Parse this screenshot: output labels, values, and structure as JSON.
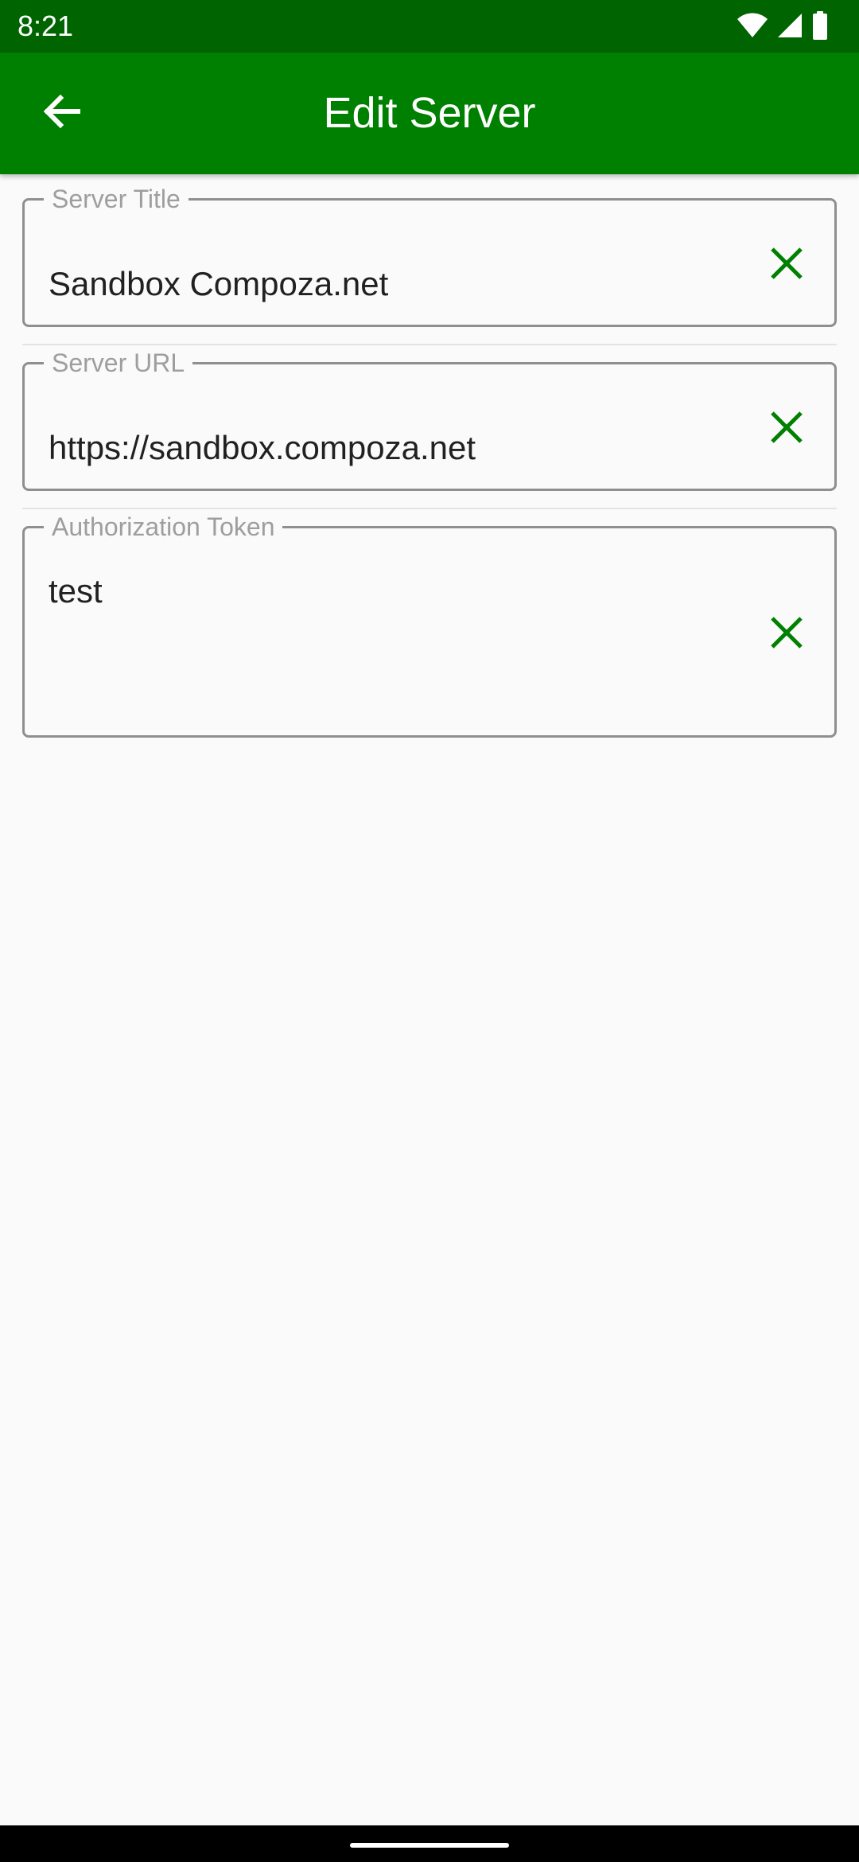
{
  "status_bar": {
    "time": "8:21",
    "icons": [
      "wifi-icon",
      "cell-signal-icon",
      "battery-icon"
    ]
  },
  "app_bar": {
    "title": "Edit Server",
    "back_icon": "arrow-back-icon",
    "background_color": "#008000"
  },
  "fields": [
    {
      "label": "Server Title",
      "value": "Sandbox Compoza.net",
      "clear_icon": "close-icon"
    },
    {
      "label": "Server URL",
      "value": "https://sandbox.compoza.net",
      "clear_icon": "close-icon"
    },
    {
      "label": "Authorization Token",
      "value": "test",
      "clear_icon": "close-icon"
    }
  ],
  "colors": {
    "accent": "#008000",
    "status_bar": "#006400"
  }
}
